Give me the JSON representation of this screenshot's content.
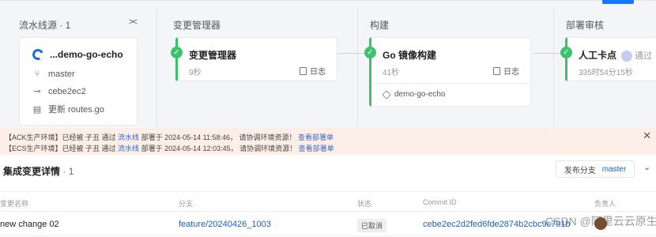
{
  "pipeline": {
    "source": {
      "title": "流水线源 · 1",
      "repo": "...demo-go-echo",
      "branch": "master",
      "commit": "cebe2ec2",
      "message": "更新 routes.go"
    },
    "stages": [
      {
        "column": "变更管理器",
        "name": "变更管理器",
        "duration": "9秒",
        "log_label": "日志",
        "status": "success"
      },
      {
        "column": "构建",
        "name": "Go 镜像构建",
        "duration": "41秒",
        "log_label": "日志",
        "artifact": "demo-go-echo",
        "status": "success"
      },
      {
        "column": "部署审核",
        "name": "人工卡点",
        "duration": "335时54分15秒",
        "approver_status": "通过",
        "status": "success"
      }
    ]
  },
  "notices": [
    {
      "prefix": "【ACK生产环境】已经被 子丑 通过",
      "pipeline": "流水线",
      "middle": "部署于 2024-05-14 11:58:46， 请协调环境资源！",
      "link": "查看部署单"
    },
    {
      "prefix": "【ECS生产环境】已经被 子丑 通过",
      "pipeline": "流水线",
      "middle": "部署于 2024-05-14 12:03:45， 请协调环境资源！",
      "link": "查看部署单"
    }
  ],
  "details": {
    "title": "集成变更详情",
    "count": "· 1",
    "publish_branch_label": "发布分支",
    "publish_branch_value": "master",
    "columns": [
      "变更名称",
      "分支",
      "状态",
      "Commit ID",
      "负责人"
    ],
    "rows": [
      {
        "name": "new change 02",
        "branch": "feature/20240426_1003",
        "status": "已取消",
        "commit": "cebe2ec2d2fed6fde2874b2cbc9c791b"
      }
    ]
  },
  "watermark": "CSDN @阿里云云原生",
  "colors": {
    "success": "#3ec16b",
    "link": "#1b5fd0",
    "notice_bg": "#fdeee7"
  }
}
